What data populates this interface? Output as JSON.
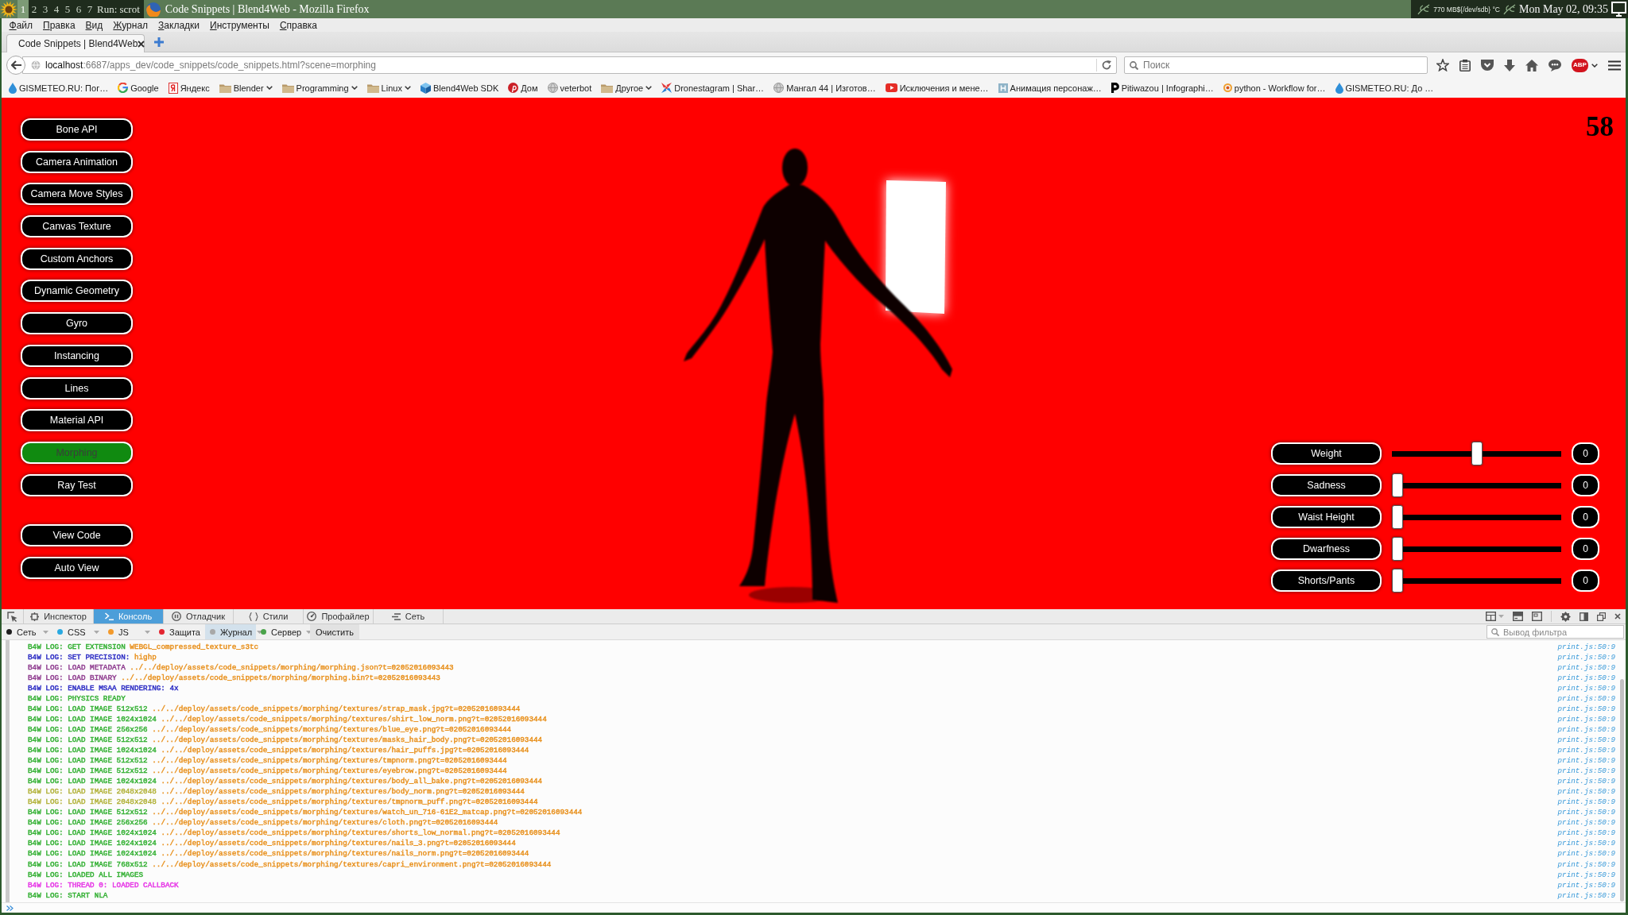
{
  "desktop_panel": {
    "workspaces": [
      {
        "label": "1",
        "selected": true
      },
      {
        "label": "2",
        "selected": false
      },
      {
        "label": "3",
        "selected": false
      },
      {
        "label": "4",
        "selected": false
      },
      {
        "label": "5",
        "selected": false
      },
      {
        "label": "6",
        "selected": false
      },
      {
        "label": "7",
        "selected": false
      }
    ],
    "run_label": "Run: scrot",
    "window_title": "Code Snippets | Blend4Web - Mozilla Firefox",
    "system_monitor": "770 MB${/dev/sdb} °C",
    "clock": "Mon May 02, 09:35"
  },
  "menu_bar": [
    "Файл",
    "Правка",
    "Вид",
    "Журнал",
    "Закладки",
    "Инструменты",
    "Справка"
  ],
  "tabs": [
    {
      "title": "Code Snippets | Blend4Web",
      "selected": true
    }
  ],
  "navigation": {
    "url_host": "localhost",
    "url_path": ":6687/apps_dev/code_snippets/code_snippets.html?scene=morphing",
    "search_placeholder": "Поиск",
    "adblock_label": "ABP"
  },
  "bookmarks": [
    {
      "label": "GISMETEO.RU: Пог…",
      "kind": "drop"
    },
    {
      "label": "Google",
      "kind": "google"
    },
    {
      "label": "Яндекс",
      "kind": "yandex"
    },
    {
      "label": "Blender",
      "kind": "folder"
    },
    {
      "label": "Programming",
      "kind": "folder"
    },
    {
      "label": "Linux",
      "kind": "folder"
    },
    {
      "label": "Blend4Web SDK",
      "kind": "cube"
    },
    {
      "label": "Дом",
      "kind": "pin"
    },
    {
      "label": "veterbot",
      "kind": "globe"
    },
    {
      "label": "Другое",
      "kind": "folder"
    },
    {
      "label": "Dronestagram | Shar…",
      "kind": "pinwheel"
    },
    {
      "label": "Мангал 44 | Изготов…",
      "kind": "globe"
    },
    {
      "label": "Исключения и мене…",
      "kind": "video"
    },
    {
      "label": "Анимация персонаж…",
      "kind": "tile"
    },
    {
      "label": "Pitiwazou | Infographi…",
      "kind": "letter"
    },
    {
      "label": "python - Workflow for…",
      "kind": "ring"
    },
    {
      "label": "GISMETEO.RU: До …",
      "kind": "drop"
    }
  ],
  "scene": {
    "buttons": [
      {
        "label": "Bone API",
        "selected": false
      },
      {
        "label": "Camera Animation",
        "selected": false
      },
      {
        "label": "Camera Move Styles",
        "selected": false
      },
      {
        "label": "Canvas Texture",
        "selected": false
      },
      {
        "label": "Custom Anchors",
        "selected": false
      },
      {
        "label": "Dynamic Geometry",
        "selected": false
      },
      {
        "label": "Gyro",
        "selected": false
      },
      {
        "label": "Instancing",
        "selected": false
      },
      {
        "label": "Lines",
        "selected": false
      },
      {
        "label": "Material API",
        "selected": false
      },
      {
        "label": "Morphing",
        "selected": true
      },
      {
        "label": "Ray Test",
        "selected": false
      }
    ],
    "action_buttons": [
      "View Code",
      "Auto View"
    ],
    "fps": "58",
    "sliders": [
      {
        "label": "Weight",
        "level": 0.5,
        "reading": "0"
      },
      {
        "label": "Sadness",
        "level": 0,
        "reading": "0"
      },
      {
        "label": "Waist Height",
        "level": 0,
        "reading": "0"
      },
      {
        "label": "Dwarfness",
        "level": 0,
        "reading": "0"
      },
      {
        "label": "Shorts/Pants",
        "level": 0,
        "reading": "0"
      }
    ]
  },
  "devtools": {
    "tabs": [
      {
        "label": "Инспектор",
        "kind": "inspector",
        "selected": false
      },
      {
        "label": "Консоль",
        "kind": "console",
        "selected": true
      },
      {
        "label": "Отладчик",
        "kind": "debugger",
        "selected": false
      },
      {
        "label": "Стили",
        "kind": "styles",
        "selected": false
      },
      {
        "label": "Профайлер",
        "kind": "profiler",
        "selected": false
      },
      {
        "label": "Сеть",
        "kind": "network",
        "selected": false
      }
    ],
    "filters": [
      {
        "label": "Сеть",
        "color": "#1e1e1e",
        "selected": false
      },
      {
        "label": "CSS",
        "color": "#29a9e1",
        "selected": false
      },
      {
        "label": "JS",
        "color": "#f39a2b",
        "selected": false
      },
      {
        "label": "Защита",
        "color": "#e3242f",
        "selected": false
      },
      {
        "label": "Журнал",
        "color": "#a8a8a8",
        "selected": true
      },
      {
        "label": "Сервер",
        "color": "#4aa34a",
        "selected": false
      }
    ],
    "clear_button": "Очистить",
    "filter_placeholder": "Вывод фильтра",
    "log": [
      {
        "message": "B4W LOG: GET EXTENSION",
        "argument": "WEBGL_compressed_texture_s3tc",
        "color": "#33b033",
        "source": "print.js:50:9"
      },
      {
        "message": "B4W LOG: SET PRECISION:",
        "argument": "highp",
        "color": "#2b2bc4",
        "source": "print.js:50:9"
      },
      {
        "message": "B4W LOG: LOAD METADATA",
        "argument": "../../deploy/assets/code_snippets/morphing/morphing.json?t=02052016093443",
        "color": "#8e3b8e",
        "source": "print.js:50:9"
      },
      {
        "message": "B4W LOG: LOAD BINARY",
        "argument": "../../deploy/assets/code_snippets/morphing/morphing.bin?t=02052016093443",
        "color": "#8e3b8e",
        "source": "print.js:50:9"
      },
      {
        "message": "B4W LOG: ENABLE MSAA RENDERING: 4x",
        "color": "#2b2bc4",
        "source": "print.js:50:9"
      },
      {
        "message": "B4W LOG: PHYSICS READY",
        "color": "#33b033",
        "source": "print.js:50:9"
      },
      {
        "message": "B4W LOG: LOAD IMAGE 512x512",
        "argument": "../../deploy/assets/code_snippets/morphing/textures/strap_mask.jpg?t=02052016093444",
        "color": "#33b033",
        "source": "print.js:50:9"
      },
      {
        "message": "B4W LOG: LOAD IMAGE 1024x1024",
        "argument": "../../deploy/assets/code_snippets/morphing/textures/shirt_low_norm.png?t=02052016093444",
        "color": "#33b033",
        "source": "print.js:50:9"
      },
      {
        "message": "B4W LOG: LOAD IMAGE 256x256",
        "argument": "../../deploy/assets/code_snippets/morphing/textures/blue_eye.png?t=02052016093444",
        "color": "#33b033",
        "source": "print.js:50:9"
      },
      {
        "message": "B4W LOG: LOAD IMAGE 512x512",
        "argument": "../../deploy/assets/code_snippets/morphing/textures/masks_hair_body.png?t=02052016093444",
        "color": "#33b033",
        "source": "print.js:50:9"
      },
      {
        "message": "B4W LOG: LOAD IMAGE 1024x1024",
        "argument": "../../deploy/assets/code_snippets/morphing/textures/hair_puffs.jpg?t=02052016093444",
        "color": "#33b033",
        "source": "print.js:50:9"
      },
      {
        "message": "B4W LOG: LOAD IMAGE 512x512",
        "argument": "../../deploy/assets/code_snippets/morphing/textures/tmpnorm.png?t=02052016093444",
        "color": "#33b033",
        "source": "print.js:50:9"
      },
      {
        "message": "B4W LOG: LOAD IMAGE 512x512",
        "argument": "../../deploy/assets/code_snippets/morphing/textures/eyebrow.png?t=02052016093444",
        "color": "#33b033",
        "source": "print.js:50:9"
      },
      {
        "message": "B4W LOG: LOAD IMAGE 1024x1024",
        "argument": "../../deploy/assets/code_snippets/morphing/textures/body_all_bake.png?t=02052016093444",
        "color": "#33b033",
        "source": "print.js:50:9"
      },
      {
        "message": "B4W LOG: LOAD IMAGE 2048x2048",
        "argument": "../../deploy/assets/code_snippets/morphing/textures/body_norm.png?t=02052016093444",
        "color": "#b2b23a",
        "source": "print.js:50:9"
      },
      {
        "message": "B4W LOG: LOAD IMAGE 2048x2048",
        "argument": "../../deploy/assets/code_snippets/morphing/textures/tmpnorm_puff.png?t=02052016093444",
        "color": "#b2b23a",
        "source": "print.js:50:9"
      },
      {
        "message": "B4W LOG: LOAD IMAGE 512x512",
        "argument": "../../deploy/assets/code_snippets/morphing/textures/watch_un_716-61E2_matcap.png?t=02052016093444",
        "color": "#33b033",
        "source": "print.js:50:9"
      },
      {
        "message": "B4W LOG: LOAD IMAGE 256x256",
        "argument": "../../deploy/assets/code_snippets/morphing/textures/cloth.png?t=02052016093444",
        "color": "#33b033",
        "source": "print.js:50:9"
      },
      {
        "message": "B4W LOG: LOAD IMAGE 1024x1024",
        "argument": "../../deploy/assets/code_snippets/morphing/textures/shorts_low_normal.png?t=02052016093444",
        "color": "#33b033",
        "source": "print.js:50:9"
      },
      {
        "message": "B4W LOG: LOAD IMAGE 1024x1024",
        "argument": "../../deploy/assets/code_snippets/morphing/textures/nails_3.png?t=02052016093444",
        "color": "#33b033",
        "source": "print.js:50:9"
      },
      {
        "message": "B4W LOG: LOAD IMAGE 1024x1024",
        "argument": "../../deploy/assets/code_snippets/morphing/textures/nails_norm.png?t=02052016093444",
        "color": "#33b033",
        "source": "print.js:50:9"
      },
      {
        "message": "B4W LOG: LOAD IMAGE 768x512",
        "argument": "../../deploy/assets/code_snippets/morphing/textures/capri_environment.png?t=02052016093444",
        "color": "#33b033",
        "source": "print.js:50:9"
      },
      {
        "message": "B4W LOG: LOADED ALL IMAGES",
        "color": "#33b033",
        "source": "print.js:50:9"
      },
      {
        "message": "B4W LOG: THREAD 0: LOADED CALLBACK",
        "color": "#e633e6",
        "source": "print.js:50:9"
      },
      {
        "message": "B4W LOG: START NLA",
        "color": "#33b033",
        "source": "print.js:50:9"
      }
    ]
  }
}
